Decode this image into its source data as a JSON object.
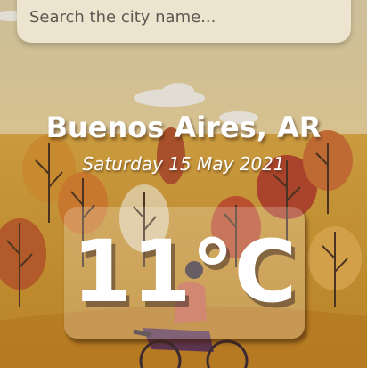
{
  "search": {
    "placeholder": "Search the city name..."
  },
  "weather": {
    "location": "Buenos Aires, AR",
    "date": "Saturday 15 May 2021",
    "temperature": "11°C"
  }
}
